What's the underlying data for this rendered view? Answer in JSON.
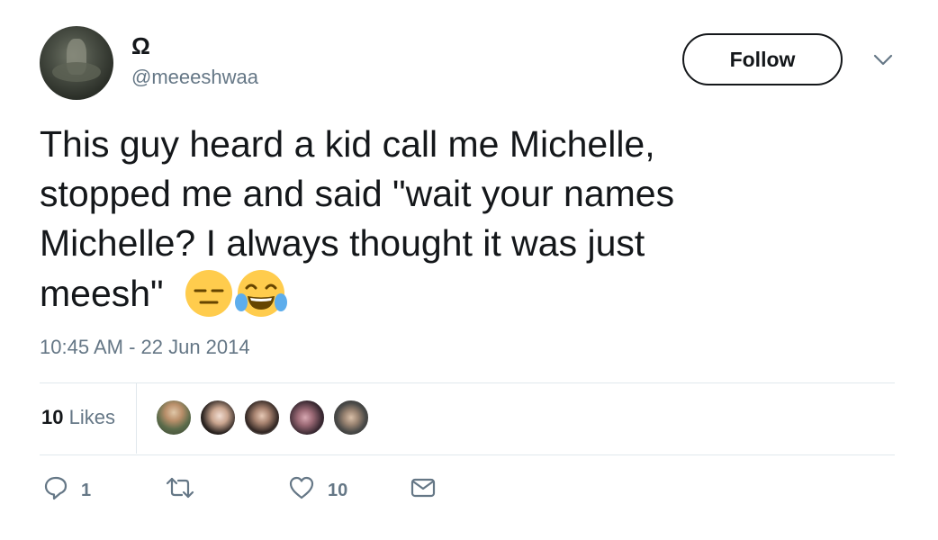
{
  "author": {
    "display_name": "Ω",
    "handle": "@meeeshwaa"
  },
  "follow_label": "Follow",
  "tweet": {
    "text": "This guy heard a kid call me Michelle,\nstopped me and said \"wait your names\nMichelle? I always thought it was just\nmeesh\"  ",
    "emojis": [
      "expressionless-face",
      "face-with-tears-of-joy"
    ],
    "timestamp": "10:45 AM - 22 Jun 2014"
  },
  "stats": {
    "likes_count": "10",
    "likes_label": "Likes"
  },
  "actions": {
    "reply_count": "1",
    "retweet_count": "",
    "like_count": "10"
  },
  "colors": {
    "text": "#14171a",
    "secondary": "#657786",
    "divider": "#e1e8ed",
    "emoji_yellow": "#ffcc4d",
    "emoji_tears": "#5dadec"
  }
}
